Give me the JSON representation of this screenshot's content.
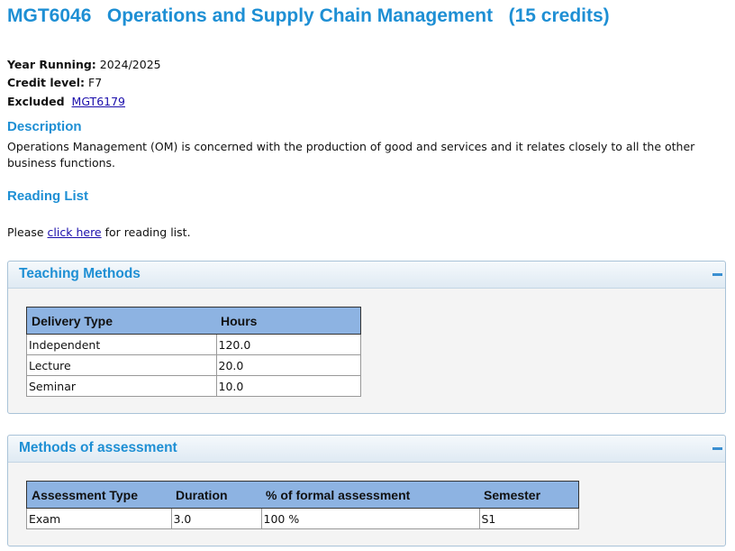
{
  "header": {
    "title": "MGT6046   Operations and Supply Chain Management   (15 credits)"
  },
  "meta": {
    "year_label": "Year Running:",
    "year_value": "2024/2025",
    "credit_label": "Credit level:",
    "credit_value": "F7",
    "excluded_label": "Excluded",
    "excluded_link": "MGT6179"
  },
  "description": {
    "heading": "Description",
    "text": "Operations Management (OM) is concerned with the production of good and services and it relates closely to all the other business functions."
  },
  "reading": {
    "heading": "Reading List",
    "prefix": "Please ",
    "link": "click here",
    "suffix": " for reading list."
  },
  "teaching": {
    "title": "Teaching Methods",
    "collapse_icon": "minus-icon",
    "headers": [
      "Delivery Type",
      "Hours"
    ],
    "rows": [
      [
        "Independent",
        "120.0"
      ],
      [
        "Lecture",
        "20.0"
      ],
      [
        "Seminar",
        "10.0"
      ]
    ]
  },
  "assessment": {
    "title": "Methods of assessment",
    "collapse_icon": "minus-icon",
    "headers": [
      "Assessment Type",
      "Duration",
      "% of formal assessment",
      "Semester"
    ],
    "rows": [
      [
        "Exam",
        "3.0",
        "100 %",
        "S1"
      ]
    ]
  },
  "colors": {
    "accent": "#1e8fd4",
    "table_header": "#8db3e2",
    "link": "#1a0dab"
  }
}
